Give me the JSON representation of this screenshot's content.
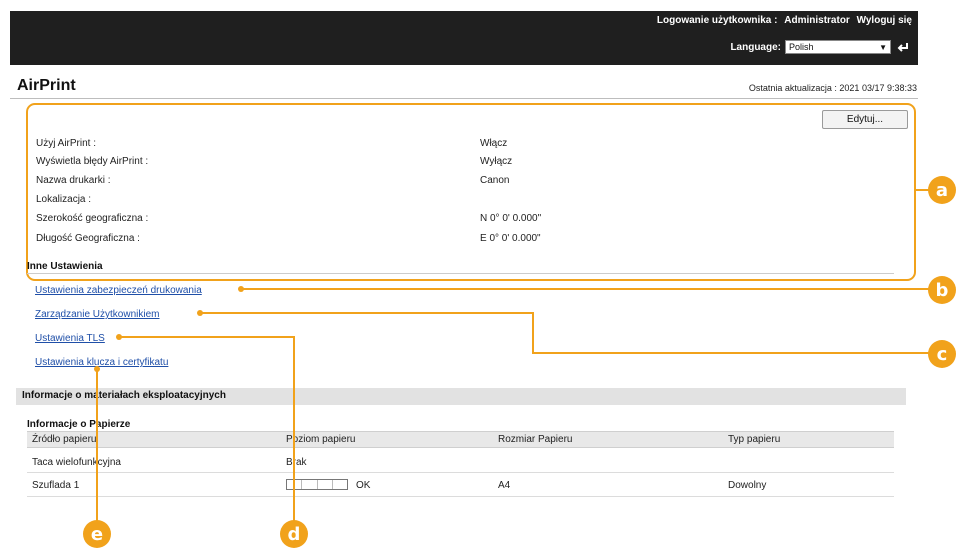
{
  "header": {
    "login_label": "Logowanie użytkownika :",
    "user": "Administrator",
    "logout": "Wyloguj się",
    "language_label": "Language:",
    "language_value": "Polish"
  },
  "page": {
    "title": "AirPrint",
    "last_update": "Ostatnia aktualizacja : 2021 03/17 9:38:33"
  },
  "edit_button": "Edytuj...",
  "settings": [
    {
      "label": "Użyj AirPrint :",
      "value": "Włącz"
    },
    {
      "label": "Wyświetla błędy AirPrint :",
      "value": "Wyłącz"
    },
    {
      "label": "Nazwa drukarki :",
      "value": "Canon"
    },
    {
      "label": "Lokalizacja :",
      "value": ""
    },
    {
      "label": "Szerokość geograficzna :",
      "value": "N 0° 0' 0.000\""
    },
    {
      "label": "Długość Geograficzna :",
      "value": "E 0° 0' 0.000\""
    }
  ],
  "other_settings": {
    "heading": "Inne Ustawienia",
    "links": [
      "Ustawienia zabezpieczeń drukowania",
      "Zarządzanie Użytkownikiem",
      "Ustawienia TLS",
      "Ustawienia klucza i certyfikatu"
    ]
  },
  "consumables": {
    "heading": "Informacje o materiałach eksploatacyjnych",
    "paper_heading": "Informacje o Papierze",
    "columns": [
      "Źródło papieru",
      "Poziom papieru",
      "Rozmiar Papieru",
      "Typ papieru"
    ],
    "rows": [
      {
        "source": "Taca wielofunkcyjna",
        "level": "Brak",
        "size": "",
        "type": ""
      },
      {
        "source": "Szuflada 1",
        "level": "OK",
        "size": "A4",
        "type": "Dowolny"
      }
    ]
  },
  "callouts": [
    "a",
    "b",
    "c",
    "d",
    "e"
  ],
  "colors": {
    "accent": "#f1a21b",
    "header_bg": "#1f1f1f",
    "link": "#1f4fa8"
  }
}
